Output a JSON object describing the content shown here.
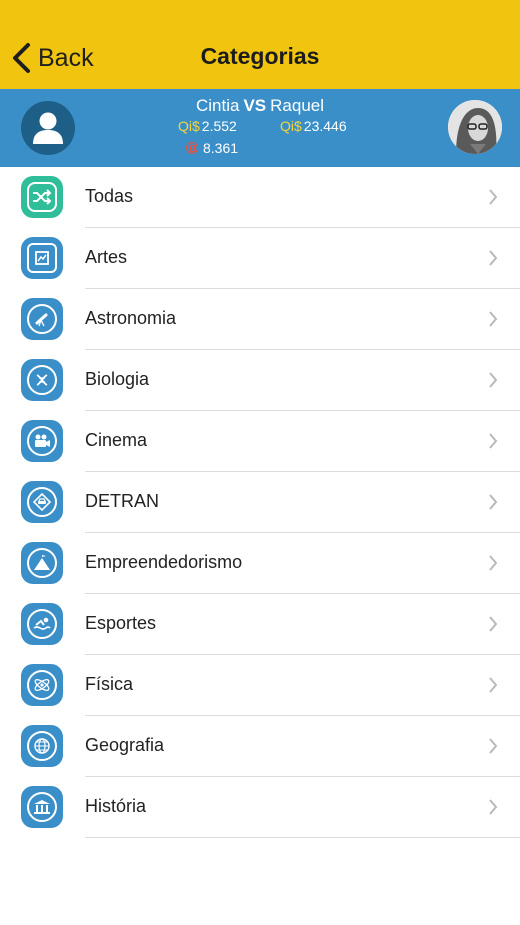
{
  "header": {
    "back_label": "Back",
    "title": "Categorias"
  },
  "match": {
    "player1": "Cintia",
    "vs": "VS",
    "player2": "Raquel",
    "currency_label": "Qi$",
    "player1_qi": "2.552",
    "player2_qi": "23.446",
    "coins": "8.361"
  },
  "colors": {
    "header_bg": "#f1c40f",
    "versus_bg": "#3b8fc9",
    "icon_blue": "#3b8fc9",
    "icon_teal": "#2fbd9a"
  },
  "categories": [
    {
      "label": "Todas",
      "icon": "shuffle-icon"
    },
    {
      "label": "Artes",
      "icon": "painting-icon"
    },
    {
      "label": "Astronomia",
      "icon": "telescope-icon"
    },
    {
      "label": "Biologia",
      "icon": "dna-icon"
    },
    {
      "label": "Cinema",
      "icon": "movie-camera-icon"
    },
    {
      "label": "DETRAN",
      "icon": "car-sign-icon"
    },
    {
      "label": "Empreendedorismo",
      "icon": "mountain-flag-icon"
    },
    {
      "label": "Esportes",
      "icon": "swimmer-icon"
    },
    {
      "label": "Física",
      "icon": "atom-icon"
    },
    {
      "label": "Geografia",
      "icon": "globe-icon"
    },
    {
      "label": "História",
      "icon": "museum-icon"
    }
  ]
}
